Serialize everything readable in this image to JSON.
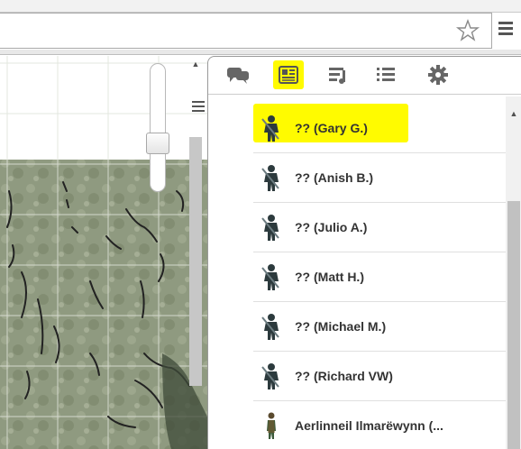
{
  "browser": {
    "icons": [
      "star-icon",
      "hamburger-menu-icon"
    ]
  },
  "sidebar": {
    "tabs": [
      {
        "id": "chat",
        "icon": "chat-bubbles-icon"
      },
      {
        "id": "journal",
        "icon": "journal-icon",
        "active": true
      },
      {
        "id": "compendium",
        "icon": "compendium-icon"
      },
      {
        "id": "list",
        "icon": "list-icon"
      },
      {
        "id": "settings",
        "icon": "gear-icon"
      }
    ],
    "roster": [
      {
        "label": "?? (Gary G.)",
        "highlighted": true
      },
      {
        "label": "?? (Anish B.)"
      },
      {
        "label": "?? (Julio A.)"
      },
      {
        "label": "?? (Matt H.)"
      },
      {
        "label": "?? (Michael M.)"
      },
      {
        "label": "?? (Richard VW)"
      },
      {
        "label": "Aerlinneil Ilmarëwynn (..."
      }
    ]
  },
  "colors": {
    "highlight": "#fffb00",
    "map_grass": "#8f9a80",
    "label_text": "#333333"
  }
}
